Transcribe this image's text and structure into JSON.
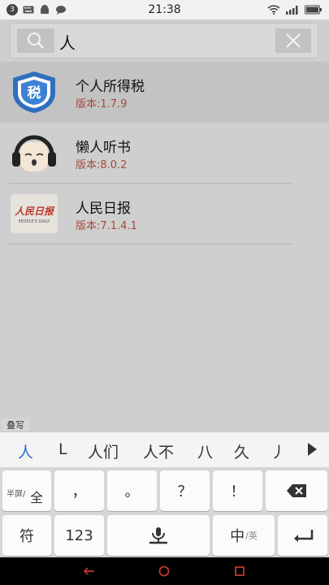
{
  "status": {
    "notif_count": "3",
    "time": "21:38"
  },
  "search": {
    "query": "人",
    "clear_label": "×"
  },
  "results": [
    {
      "name": "个人所得税",
      "version": "版本:1.7.9",
      "icon_label": "税"
    },
    {
      "name": "懒人听书",
      "version": "版本:8.0.2"
    },
    {
      "name": "人民日报",
      "version": "版本:7.1.4.1",
      "icon_label": "人民日报",
      "icon_sub": "PEOPLE'S DAILY"
    }
  ],
  "keyboard": {
    "fold_label": "叠写",
    "candidates": [
      "人",
      "L",
      "人们",
      "人不",
      "八",
      "久",
      "丿"
    ],
    "row1": {
      "half_label": "半屏/",
      "full_label": "全",
      "comma": "，",
      "period": "。",
      "question": "？",
      "exclaim": "！"
    },
    "row2": {
      "symbol": "符",
      "numbers": "123",
      "lang_main": "中",
      "lang_sub": "/英"
    }
  },
  "colors": {
    "accent_blue": "#2a6fcf",
    "version_red": "#a24b3c"
  }
}
